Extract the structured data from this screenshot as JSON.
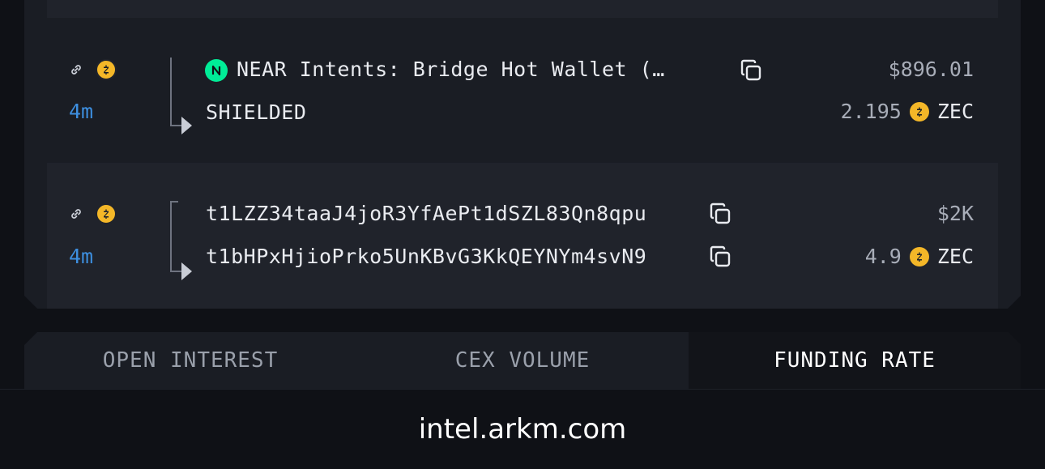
{
  "transfers": [
    {
      "age": "4m",
      "from_label": "NEAR Intents: Bridge Hot Wallet (…",
      "from_icon": "near-logo-icon",
      "to_label": "SHIELDED",
      "usd_value": "$896.01",
      "amount": "2.195",
      "token": "ZEC"
    },
    {
      "age": "4m",
      "from_label": "t1LZZ34taaJ4joR3YfAePt1dSZL83Qn8qpu",
      "to_label": "t1bHPxHjioPrko5UnKBvG3KkQEYNYm4svN9",
      "usd_value": "$2K",
      "amount": "4.9",
      "token": "ZEC"
    }
  ],
  "tabs": [
    {
      "label": "OPEN INTEREST",
      "active": false
    },
    {
      "label": "CEX VOLUME",
      "active": false
    },
    {
      "label": "FUNDING RATE",
      "active": true
    }
  ],
  "footer": {
    "domain": "intel.arkm.com"
  },
  "colors": {
    "accent_blue": "#3d8fe0",
    "zec_gold": "#f4b728",
    "near_green": "#00ec97"
  }
}
